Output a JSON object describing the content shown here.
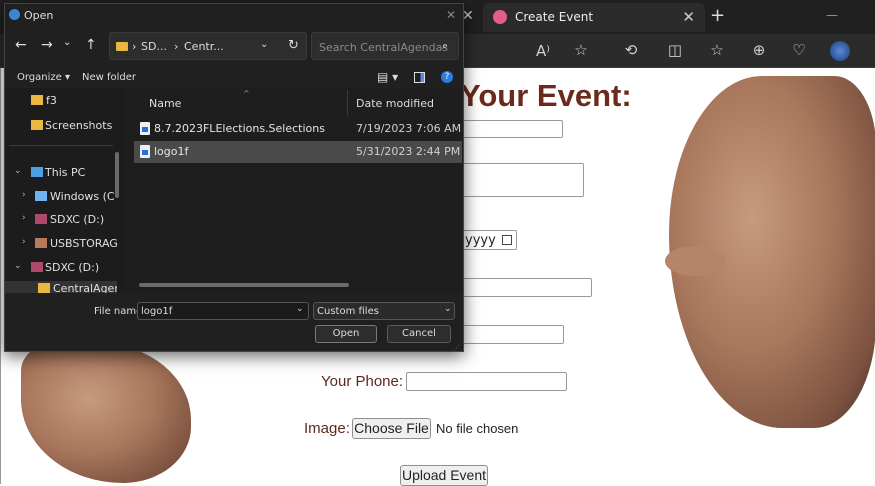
{
  "browser": {
    "tab_title": "Create Event",
    "tab_close": "✕",
    "new_tab": "+",
    "minimize": "—",
    "prev_tab_close": "✕",
    "toolbar_icons": [
      "A⁾",
      "☆",
      "⟲",
      "◫",
      "☆",
      "⊕",
      "♡"
    ]
  },
  "page": {
    "heading": "Your Event:",
    "date_placeholder": "yyyy",
    "phone_label": "Your Phone:",
    "image_label": "Image:",
    "choose_file": "Choose File",
    "no_file": "No file chosen",
    "upload_button": "Upload Event"
  },
  "dialog": {
    "title": "Open",
    "title_close": "✕",
    "path": [
      "SD...",
      "Centr..."
    ],
    "search_placeholder": "Search CentralAgendas",
    "organize": "Organize ▾",
    "new_folder": "New folder",
    "nav_items": [
      {
        "label": "f3",
        "type": "folder"
      },
      {
        "label": "Screenshots",
        "type": "folder"
      },
      {
        "label": "This PC",
        "type": "pc"
      },
      {
        "label": "Windows (C",
        "type": "drive"
      },
      {
        "label": "SDXC (D:)",
        "type": "drive"
      },
      {
        "label": "USBSTORAG",
        "type": "drive"
      },
      {
        "label": "SDXC (D:)",
        "type": "drive"
      },
      {
        "label": "CentralAgen",
        "type": "folder"
      }
    ],
    "columns": {
      "name": "Name",
      "date": "Date modified"
    },
    "files": [
      {
        "name": "8.7.2023FLElections.Selections",
        "date": "7/19/2023 7:06 AM",
        "selected": false
      },
      {
        "name": "logo1f",
        "date": "5/31/2023 2:44 PM",
        "selected": true
      }
    ],
    "file_name_label": "File name:",
    "file_name_value": "logo1f",
    "file_type": "Custom files",
    "open_button": "Open",
    "cancel_button": "Cancel"
  }
}
